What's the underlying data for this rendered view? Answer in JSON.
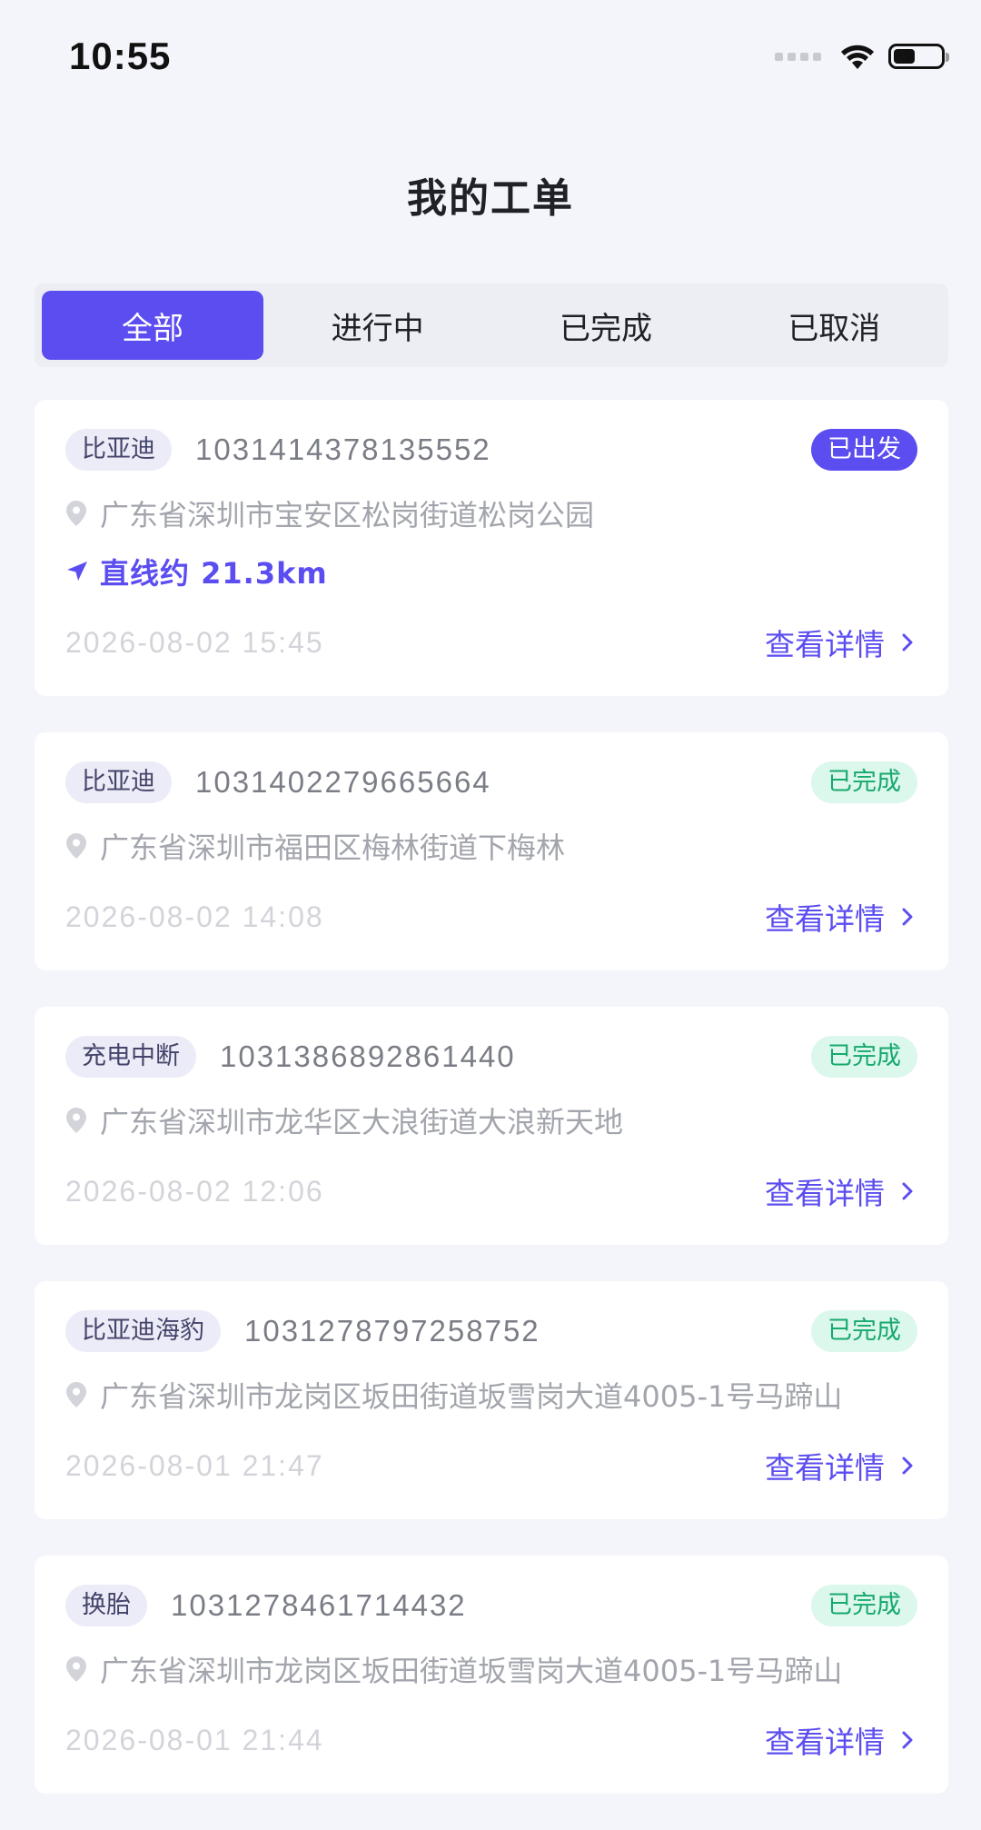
{
  "status_bar": {
    "time": "10:55",
    "battery_level": 0.45
  },
  "header": {
    "title": "我的工单"
  },
  "tabs": [
    {
      "label": "全部",
      "active": true
    },
    {
      "label": "进行中",
      "active": false
    },
    {
      "label": "已完成",
      "active": false
    },
    {
      "label": "已取消",
      "active": false
    }
  ],
  "orders": [
    {
      "tag": "比亚迪",
      "order_no": "1031414378135552",
      "status": "已出发",
      "address": "广东省深圳市宝安区松岗街道松岗公园",
      "distance": "直线约 21.3km",
      "time": "2026-08-02 15:45",
      "detail_label": "查看详情"
    },
    {
      "tag": "比亚迪",
      "order_no": "1031402279665664",
      "status": "已完成",
      "address": "广东省深圳市福田区梅林街道下梅林",
      "time": "2026-08-02 14:08",
      "detail_label": "查看详情"
    },
    {
      "tag": "充电中断",
      "order_no": "1031386892861440",
      "status": "已完成",
      "address": "广东省深圳市龙华区大浪街道大浪新天地",
      "time": "2026-08-02 12:06",
      "detail_label": "查看详情"
    },
    {
      "tag": "比亚迪海豹",
      "order_no": "1031278797258752",
      "status": "已完成",
      "address": "广东省深圳市龙岗区坂田街道坂雪岗大道4005-1号马蹄山",
      "time": "2026-08-01 21:47",
      "detail_label": "查看详情"
    },
    {
      "tag": "换胎",
      "order_no": "1031278461714432",
      "status": "已完成",
      "address": "广东省深圳市龙岗区坂田街道坂雪岗大道4005-1号马蹄山",
      "time": "2026-08-01 21:44",
      "detail_label": "查看详情"
    }
  ],
  "colors": {
    "accent": "#5b4df0",
    "success": "#17a96e",
    "success_bg": "#dcf7ec",
    "background": "#f4f4fb"
  },
  "icons": {
    "location": "map-pin-icon",
    "navigation": "navigation-arrow-icon",
    "detail": "chevron-right-icon",
    "wifi": "wifi-icon",
    "battery": "battery-icon"
  }
}
